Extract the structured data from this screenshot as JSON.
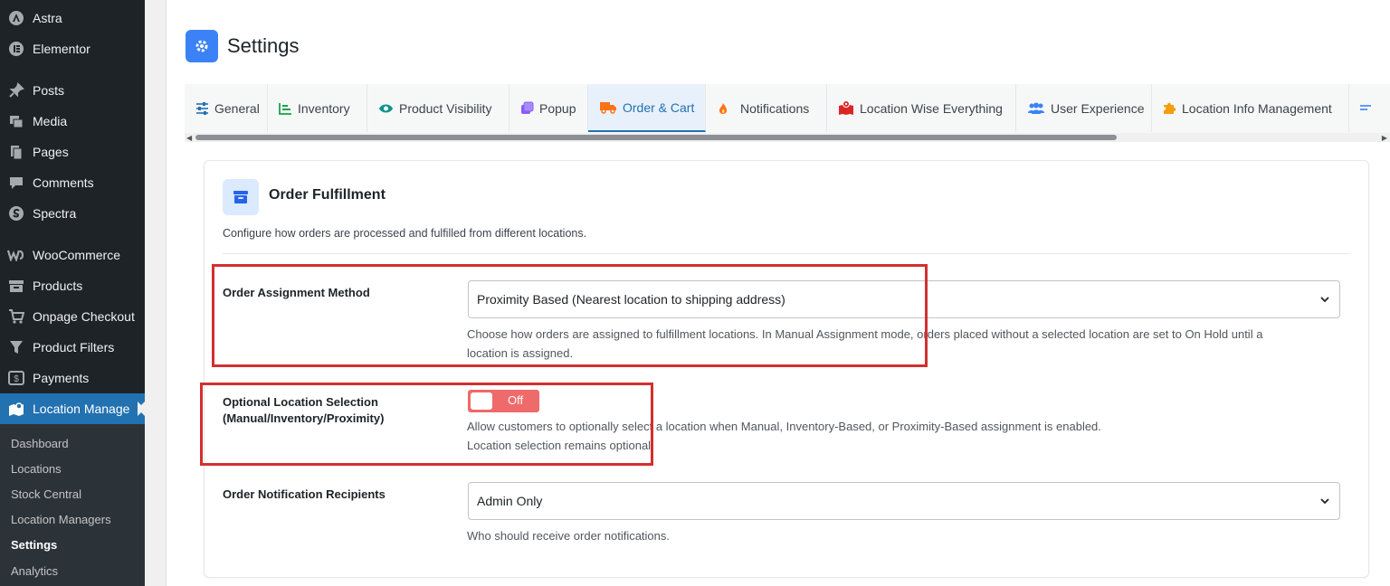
{
  "sidebar": {
    "items": [
      {
        "label": "Astra",
        "icon": "astra-icon"
      },
      {
        "label": "Elementor",
        "icon": "elementor-icon"
      },
      {
        "label": "Posts",
        "icon": "pin-icon"
      },
      {
        "label": "Media",
        "icon": "media-icon"
      },
      {
        "label": "Pages",
        "icon": "pages-icon"
      },
      {
        "label": "Comments",
        "icon": "comment-icon"
      },
      {
        "label": "Spectra",
        "icon": "spectra-icon"
      },
      {
        "label": "WooCommerce",
        "icon": "woo-icon"
      },
      {
        "label": "Products",
        "icon": "archive-icon"
      },
      {
        "label": "Onpage Checkout",
        "icon": "cart-icon"
      },
      {
        "label": "Product Filters",
        "icon": "filter-icon"
      },
      {
        "label": "Payments",
        "icon": "payments-icon"
      },
      {
        "label": "Location Manage",
        "icon": "map-icon"
      }
    ],
    "submenu": [
      "Dashboard",
      "Locations",
      "Stock Central",
      "Location Managers",
      "Settings",
      "Analytics"
    ]
  },
  "header": {
    "title": "Settings"
  },
  "tabs": [
    {
      "label": "General",
      "icon": "sliders-icon",
      "color": "#2271b1"
    },
    {
      "label": "Inventory",
      "icon": "chart-bars-icon",
      "color": "#16a34a"
    },
    {
      "label": "Product Visibility",
      "icon": "eye-icon",
      "color": "#0d9488"
    },
    {
      "label": "Popup",
      "icon": "clone-icon",
      "color": "#8b5cf6"
    },
    {
      "label": "Order & Cart",
      "icon": "truck-icon",
      "color": "#f97316"
    },
    {
      "label": "Notifications",
      "icon": "fire-icon",
      "color": "#f97316"
    },
    {
      "label": "Location Wise Everything",
      "icon": "map-marked-icon",
      "color": "#dc2626"
    },
    {
      "label": "User Experience",
      "icon": "users-icon",
      "color": "#3b82f6"
    },
    {
      "label": "Location Info Management",
      "icon": "puzzle-icon",
      "color": "#f59e0b"
    },
    {
      "label": "",
      "icon": "list-icon",
      "color": "#3b82f6"
    }
  ],
  "card": {
    "title": "Order Fulfillment",
    "description": "Configure how orders are processed and fulfilled from different locations.",
    "rows": {
      "assignment": {
        "label": "Order Assignment Method",
        "value": "Proximity Based (Nearest location to shipping address)",
        "help1": "Choose how orders are assigned to fulfillment locations. In Manual Assignment mode, orders placed without a selected location are set to On Hold until a",
        "help2": "location is assigned."
      },
      "optional": {
        "label1": "Optional Location Selection",
        "label2": "(Manual/Inventory/Proximity)",
        "toggle": "Off",
        "help1": "Allow customers to optionally select a location when Manual, Inventory-Based, or Proximity-Based assignment is enabled.",
        "help2": "Location selection remains optional."
      },
      "recipients": {
        "label": "Order Notification Recipients",
        "value": "Admin Only",
        "help": "Who should receive order notifications."
      }
    }
  },
  "colors": {
    "accent": "#2271b1",
    "toggle_off": "#ef6a6a",
    "highlight": "#d32f2f"
  }
}
